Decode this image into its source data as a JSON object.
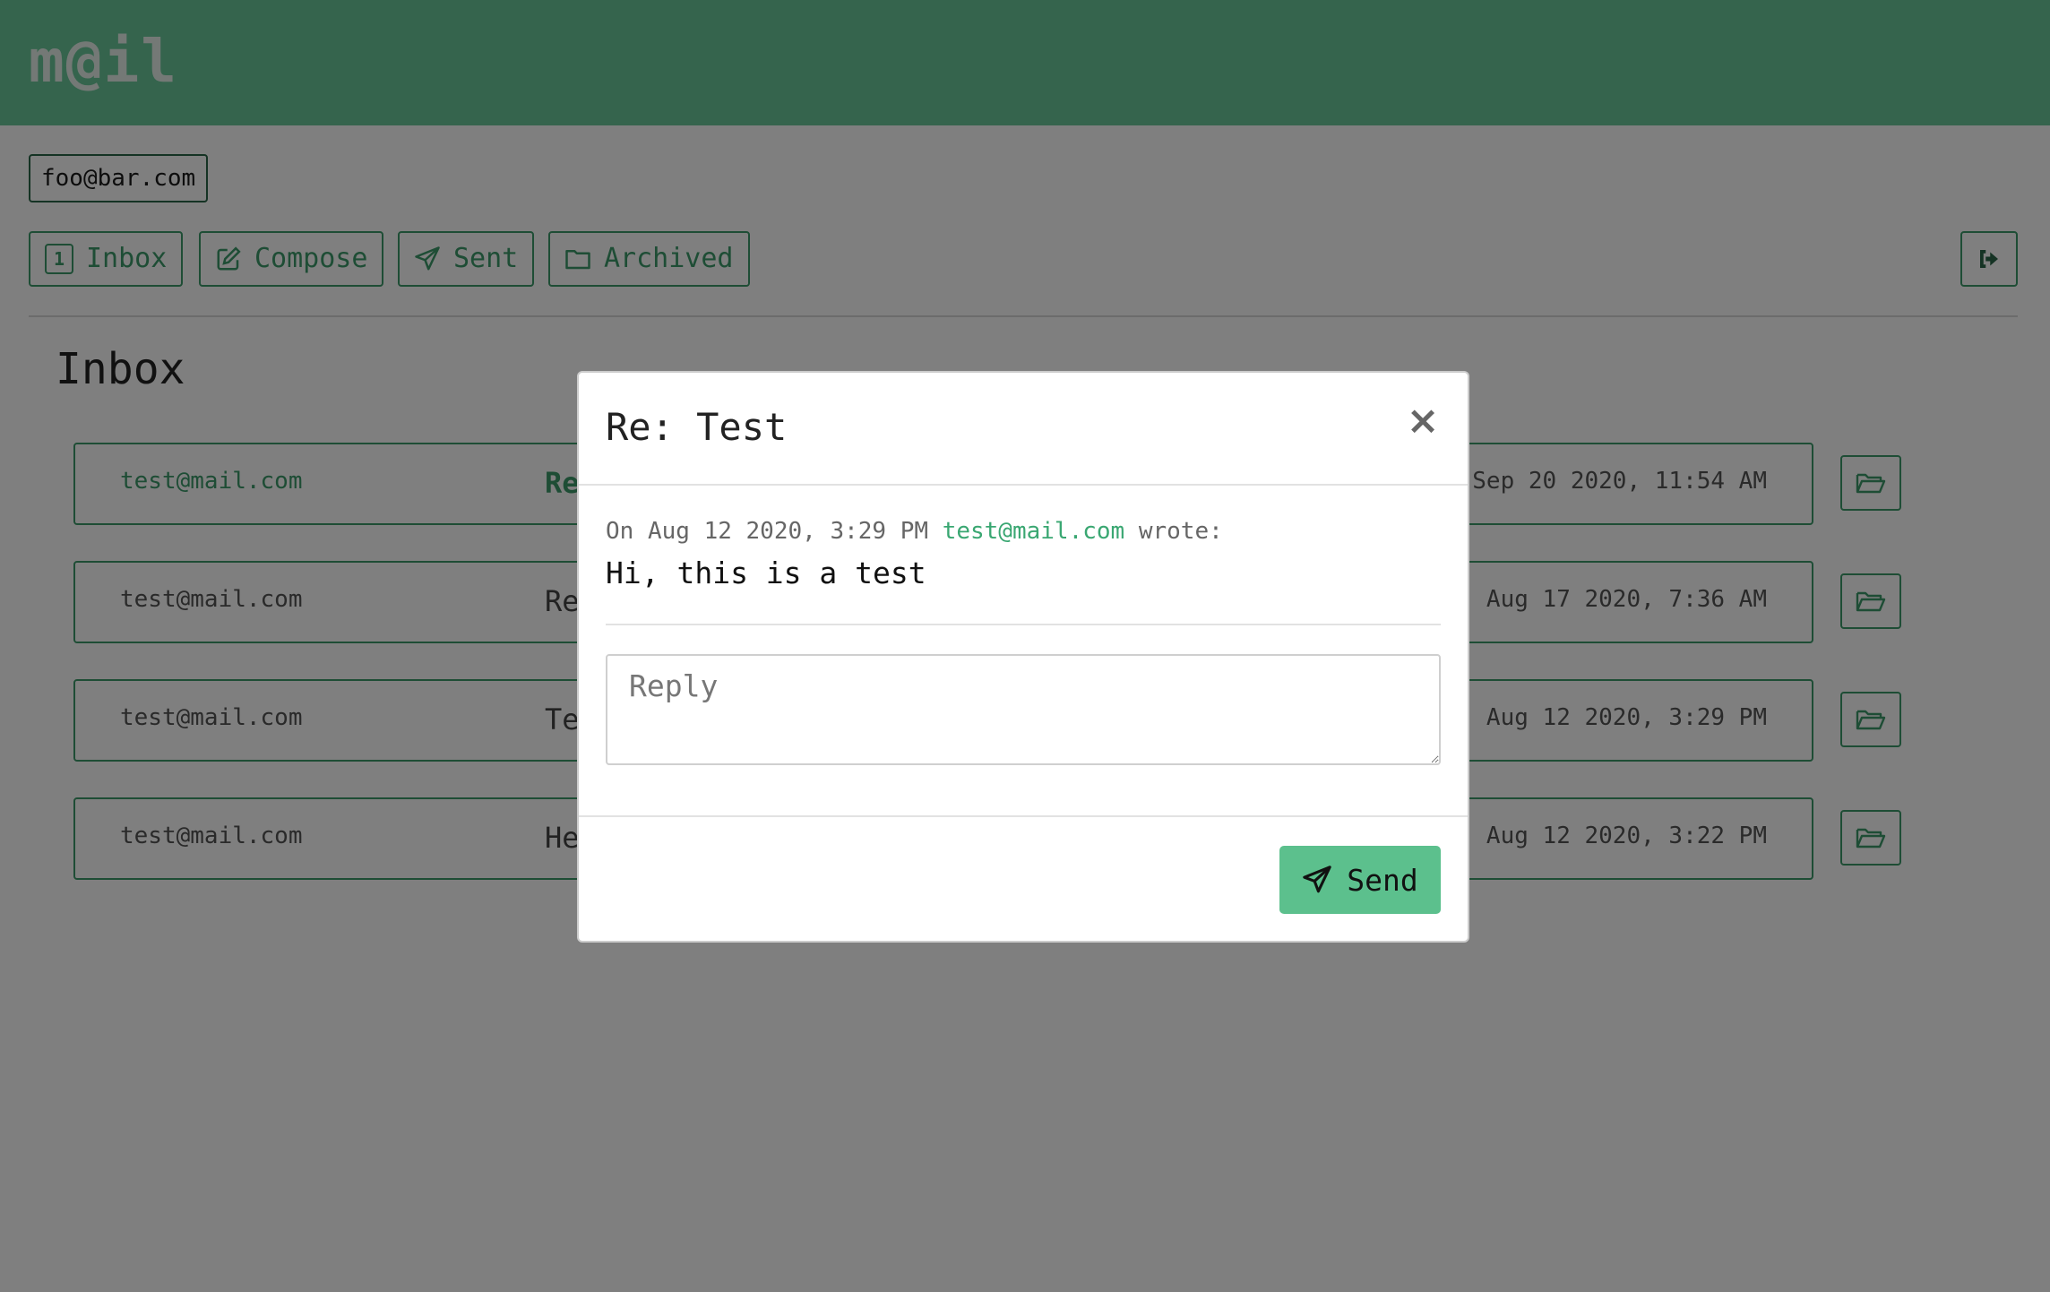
{
  "app": {
    "logo": "m@il"
  },
  "user": {
    "email": "foo@bar.com"
  },
  "nav": {
    "inbox": {
      "label": "Inbox",
      "count": "1"
    },
    "compose": {
      "label": "Compose"
    },
    "sent": {
      "label": "Sent"
    },
    "archived": {
      "label": "Archived"
    }
  },
  "page": {
    "title": "Inbox"
  },
  "emails": [
    {
      "from": "test@mail.com",
      "subject": "Re",
      "date": "Sep 20 2020, 11:54 AM"
    },
    {
      "from": "test@mail.com",
      "subject": "Re",
      "date": "Aug 17 2020, 7:36 AM"
    },
    {
      "from": "test@mail.com",
      "subject": "Te",
      "date": "Aug 12 2020, 3:29 PM"
    },
    {
      "from": "test@mail.com",
      "subject": "He",
      "date": "Aug 12 2020, 3:22 PM"
    }
  ],
  "modal": {
    "title": "Re: Test",
    "close": "×",
    "quote_prefix": "On Aug 12 2020, 3:29 PM",
    "quote_sender": "test@mail.com",
    "quote_suffix": "wrote:",
    "quote_body": "Hi, this is a test",
    "reply_placeholder": "Reply",
    "send_label": "Send"
  },
  "colors": {
    "accent": "#3c9a6a",
    "header": "#6ac99a",
    "send": "#5cc08d"
  }
}
